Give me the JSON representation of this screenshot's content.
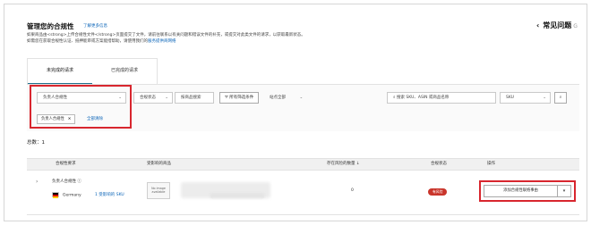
{
  "header": {
    "title": "管理您的合规性",
    "learn_more": "了解更多信息",
    "desc_line1": "如果商品由<strong>上传合规性文件</strong>页面提交了文件，请前往联系以有关问题和错误文件的补充，或提交对此类文件的请求，以获取最新状态。",
    "desc_line2_text": "如需您在获取合规性认证、抵押能审或方案能措帮助，请使用我们的",
    "desc_line2_link": "服务提供商网络"
  },
  "faq": {
    "chevron": "‹",
    "label": "常见问题",
    "badge": "G"
  },
  "tabs": [
    {
      "label": "未完成的请求",
      "active": true
    },
    {
      "label": "已完成的请求",
      "active": false
    }
  ],
  "filters": {
    "responsible_select": "负责人合规性",
    "status_select": "合规状态",
    "search_placeholder_1": "按商品搜索",
    "filter_button": "所有筛选条件",
    "market_select": "站点全部",
    "search_placeholder_2": "搜索 SKU、ASIN 或商品名称",
    "sku_select": "SKU",
    "chip_label": "负责人合规性",
    "chip_close": "×",
    "clear_all": "全部清除"
  },
  "total": {
    "label": "总数：",
    "value": "1"
  },
  "table": {
    "columns": [
      "合规性要求",
      "受影响的商品",
      "存在风险的数量 ↓",
      "合规状态",
      "操作"
    ],
    "rows": [
      {
        "expander": "›",
        "requirement": "负责人合规性 ⓘ",
        "country": "Germany",
        "affected": "1 受影响的 SKU",
        "thumb_text": "No image available",
        "at_risk": "0",
        "status": "有风险",
        "action_label": "添加合规性联络事由",
        "action_dd": "▾"
      }
    ]
  },
  "colors": {
    "highlight": "#d8262e",
    "link": "#0a64b8",
    "status_red": "#c9352b"
  }
}
